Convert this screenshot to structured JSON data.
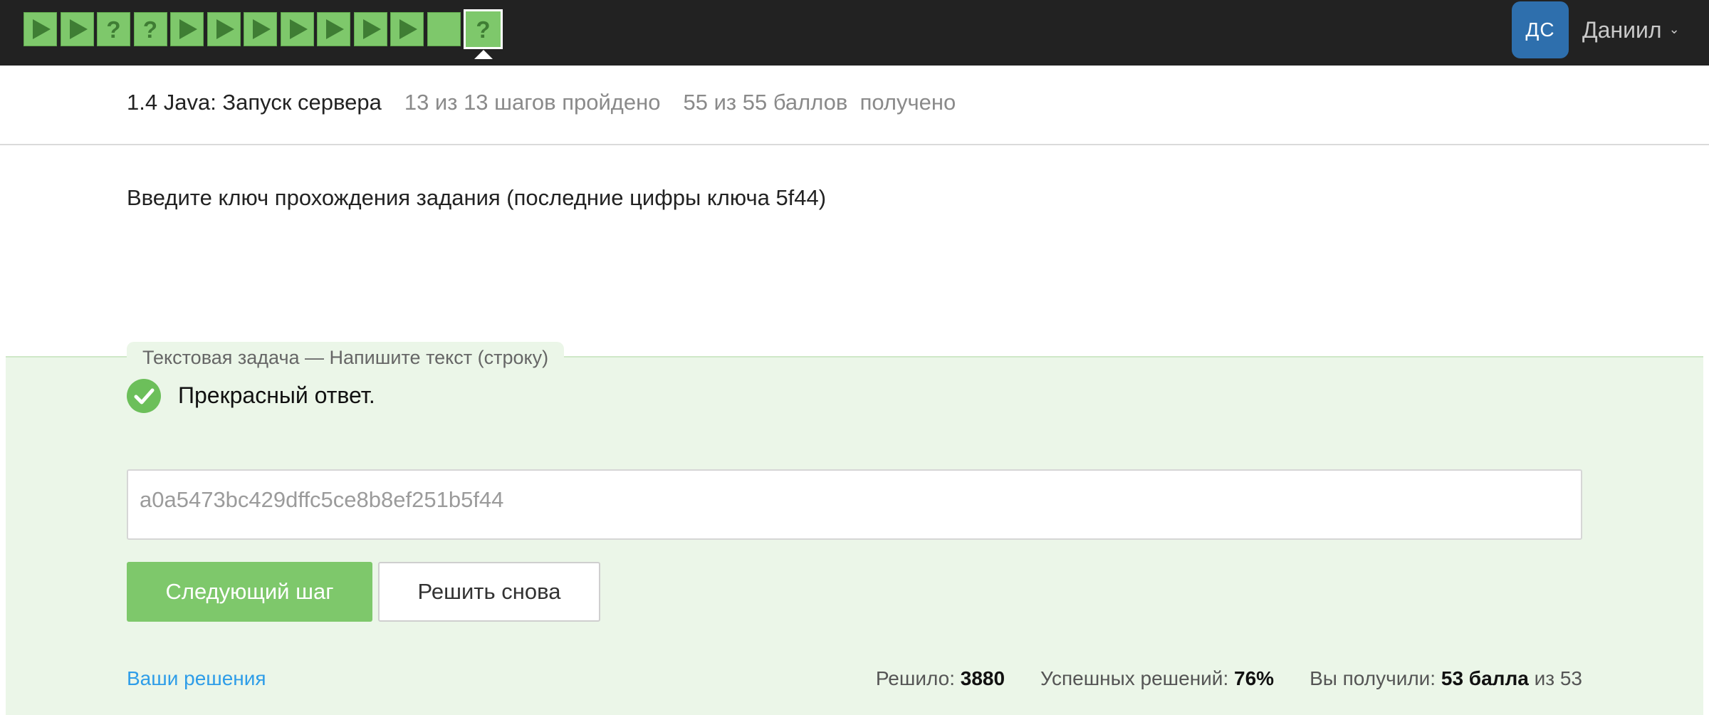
{
  "steps": [
    {
      "kind": "play"
    },
    {
      "kind": "play"
    },
    {
      "kind": "question"
    },
    {
      "kind": "question"
    },
    {
      "kind": "play"
    },
    {
      "kind": "play"
    },
    {
      "kind": "play"
    },
    {
      "kind": "play"
    },
    {
      "kind": "play"
    },
    {
      "kind": "play"
    },
    {
      "kind": "play"
    },
    {
      "kind": "blank"
    },
    {
      "kind": "question",
      "current": true
    }
  ],
  "colors": {
    "topbar": "#222222",
    "step_passed": "#7ec86b",
    "step_glyph": "#3f7d34",
    "avatar": "#2e6fad",
    "quiz_bg": "#ebf6e8",
    "accent_green": "#7ec86b",
    "link": "#2e9de8"
  },
  "user": {
    "initials": "ДС",
    "name": "Даниил"
  },
  "lesson": {
    "title": "1.4 Java: Запуск сервера",
    "steps_progress": "13 из 13 шагов пройдено",
    "points_progress": "55 из 55 баллов  получено"
  },
  "prompt": "Введите ключ прохождения задания (последние цифры ключа 5f44)",
  "quiz": {
    "type_label": "Текстовая задача — Напишите текст (строку)",
    "feedback": "Прекрасный ответ.",
    "answer_value": "a0a5473bc429dffc5ce8b8ef251b5f44",
    "next_label": "Следующий шаг",
    "retry_label": "Решить снова",
    "solutions_link": "Ваши решения",
    "stats": {
      "solved_label": "Решило:",
      "solved_value": "3880",
      "success_label": "Успешных решений:",
      "success_value": "76%",
      "earned_label": "Вы получили:",
      "earned_value": "53 балла",
      "earned_of": "из 53"
    }
  }
}
